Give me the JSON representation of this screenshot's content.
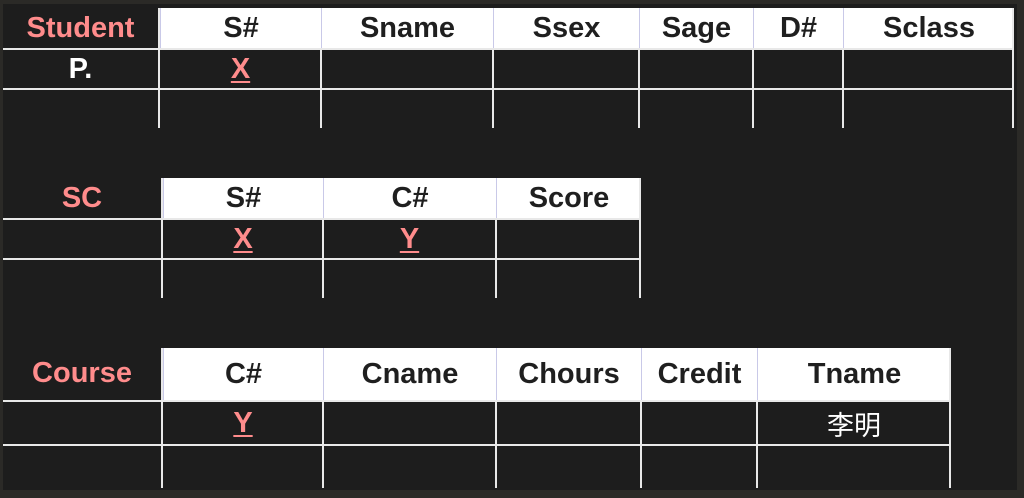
{
  "tables": {
    "student": {
      "name": "Student",
      "columns": [
        "S#",
        "Sname",
        "Ssex",
        "Sage",
        "D#",
        "Sclass"
      ],
      "row1": {
        "command": "P.",
        "cells": [
          "X",
          "",
          "",
          "",
          "",
          ""
        ]
      }
    },
    "sc": {
      "name": "SC",
      "columns": [
        "S#",
        "C#",
        "Score"
      ],
      "row1": {
        "command": "",
        "cells": [
          "X",
          "Y",
          ""
        ]
      }
    },
    "course": {
      "name": "Course",
      "columns": [
        "C#",
        "Cname",
        "Chours",
        "Credit",
        "Tname"
      ],
      "row1": {
        "command": "",
        "cells": [
          "Y",
          "",
          "",
          "",
          "李明"
        ]
      }
    }
  },
  "colors": {
    "background": "#1d1d1d",
    "relation_name": "#ff8c8c",
    "example_element": "#ff8c8c",
    "header_fill": "#ffffff",
    "grid_line": "#e8e8e8"
  }
}
